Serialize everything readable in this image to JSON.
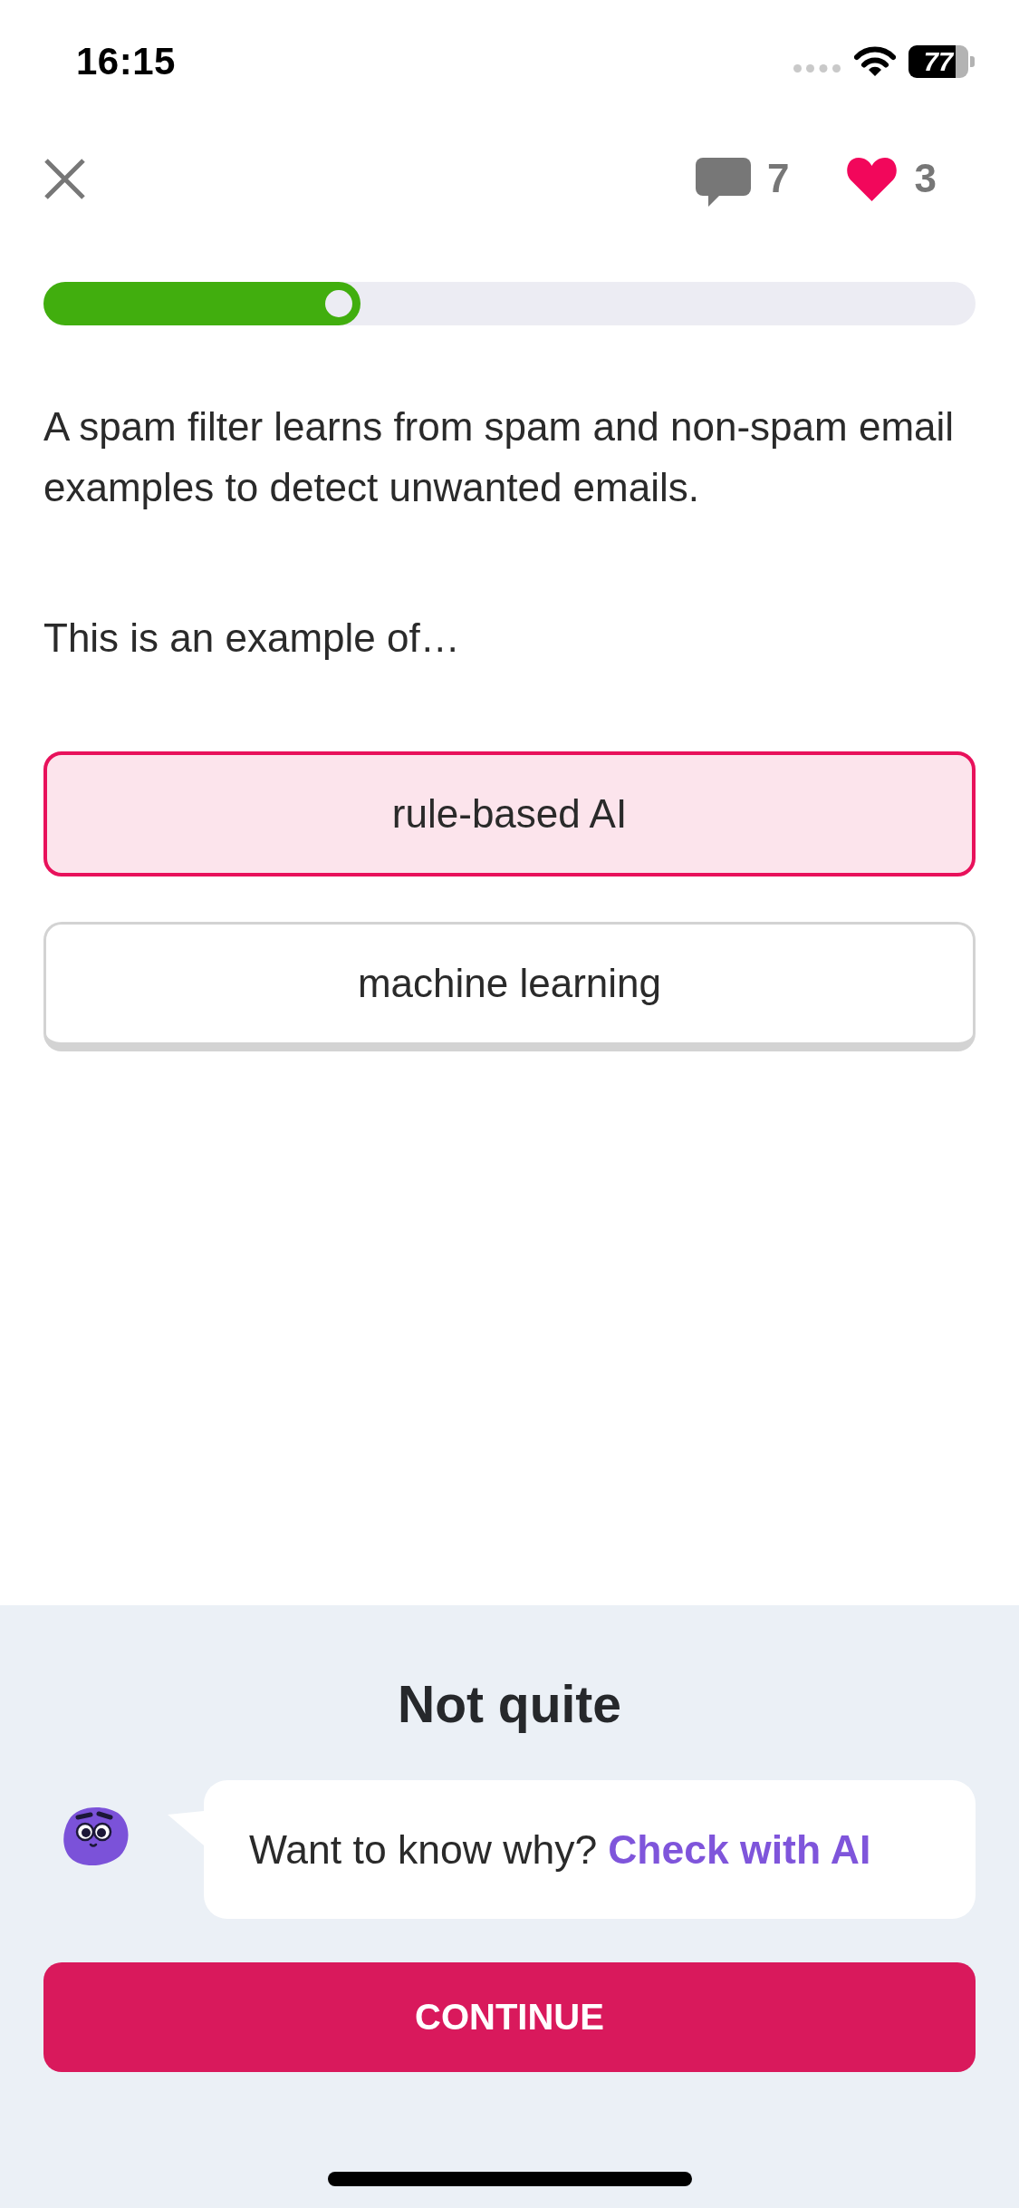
{
  "status_bar": {
    "time": "16:15",
    "battery": "77"
  },
  "top_bar": {
    "comments": "7",
    "hearts": "3"
  },
  "progress": {
    "level": 0.34
  },
  "question": {
    "text": "A spam filter learns from spam and non-spam email examples to detect unwanted emails.",
    "prompt": "This is an example of…"
  },
  "options": [
    {
      "label": "rule-based AI",
      "selected": true
    },
    {
      "label": "machine learning",
      "selected": false
    }
  ],
  "feedback": {
    "title": "Not quite",
    "message": "Want to know why?",
    "link": "Check with AI",
    "button": "CONTINUE"
  }
}
